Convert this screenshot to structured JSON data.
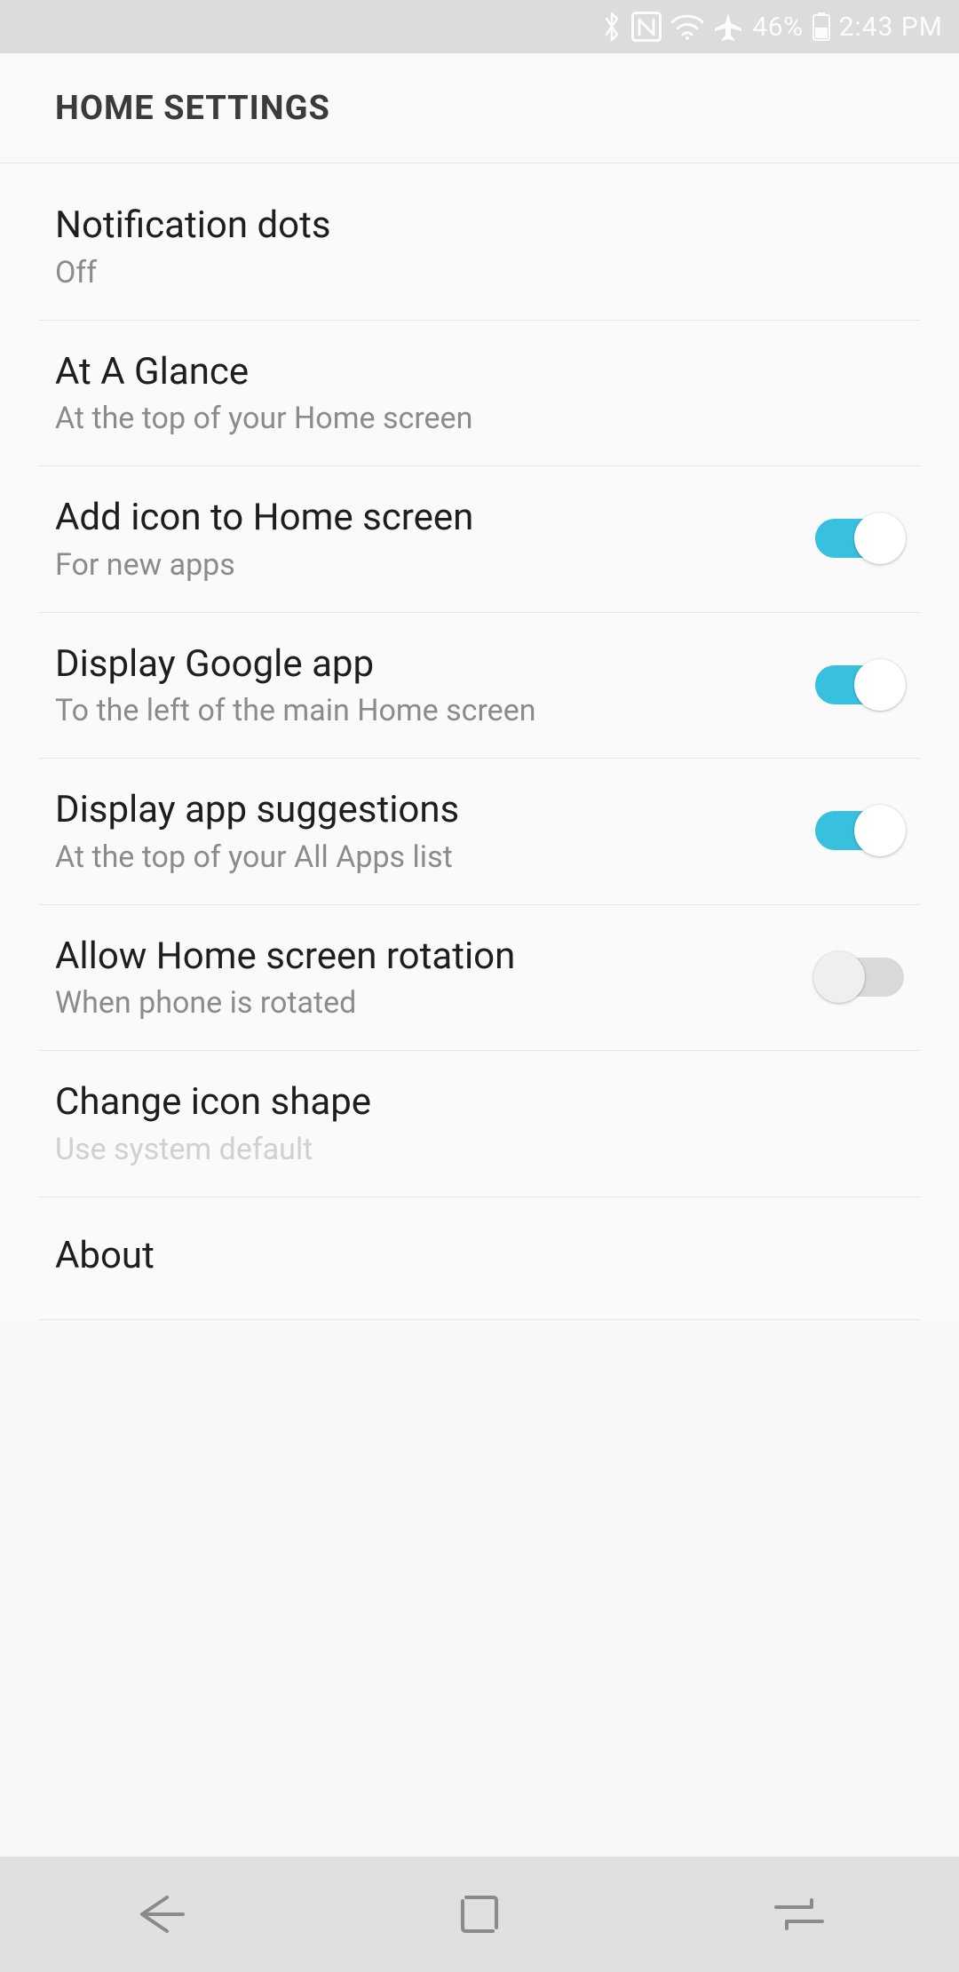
{
  "status": {
    "battery_pct": "46%",
    "time": "2:43 PM"
  },
  "header": {
    "title": "HOME SETTINGS"
  },
  "items": {
    "notification_dots": {
      "title": "Notification dots",
      "sub": "Off"
    },
    "at_a_glance": {
      "title": "At A Glance",
      "sub": "At the top of your Home screen"
    },
    "add_icon": {
      "title": "Add icon to Home screen",
      "sub": "For new apps"
    },
    "google_app": {
      "title": "Display Google app",
      "sub": "To the left of the main Home screen"
    },
    "app_sugg": {
      "title": "Display app suggestions",
      "sub": "At the top of your All Apps list"
    },
    "rotation": {
      "title": "Allow Home screen rotation",
      "sub": "When phone is rotated"
    },
    "icon_shape": {
      "title": "Change icon shape",
      "sub": "Use system default"
    },
    "about": {
      "title": "About"
    }
  },
  "toggles": {
    "add_icon": true,
    "google_app": true,
    "app_sugg": true,
    "rotation": false
  }
}
